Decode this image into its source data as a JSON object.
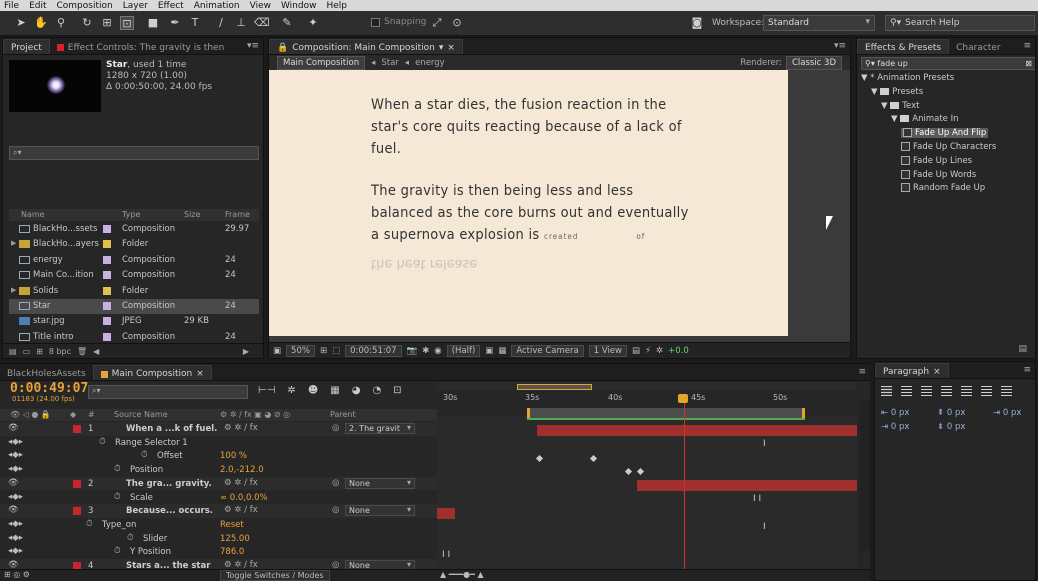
{
  "menu": [
    "File",
    "Edit",
    "Composition",
    "Layer",
    "Effect",
    "Animation",
    "View",
    "Window",
    "Help"
  ],
  "toolbar": {
    "snapping_label": "Snapping",
    "workspace_label": "Workspace:",
    "workspace_value": "Standard",
    "search_placeholder": "Search Help"
  },
  "project_panel": {
    "tabs": [
      "Project",
      "Effect Controls: The gravity is then"
    ],
    "selected_item": {
      "name": "Star",
      "used": ", used 1 time",
      "resolution": "1280 x 720 (1.00)",
      "duration": "Δ 0:00:50:00, 24.00 fps"
    },
    "search_placeholder": "⌕▾",
    "columns": [
      "Name",
      "Type",
      "Size",
      "Frame ..."
    ],
    "items": [
      {
        "name": "BlackHo...ssets",
        "type": "Composition",
        "size": "",
        "frame": "29.97",
        "kind": "comp",
        "swatch": "#c9b0e0"
      },
      {
        "name": "BlackHo...ayers",
        "type": "Folder",
        "size": "",
        "frame": "",
        "kind": "folder",
        "swatch": "#e0c24a"
      },
      {
        "name": "energy",
        "type": "Composition",
        "size": "",
        "frame": "24",
        "kind": "comp",
        "swatch": "#c9b0e0"
      },
      {
        "name": "Main Co...ition",
        "type": "Composition",
        "size": "",
        "frame": "24",
        "kind": "comp",
        "swatch": "#c9b0e0"
      },
      {
        "name": "Solids",
        "type": "Folder",
        "size": "",
        "frame": "",
        "kind": "folder",
        "swatch": "#e0c24a"
      },
      {
        "name": "Star",
        "type": "Composition",
        "size": "",
        "frame": "24",
        "kind": "comp",
        "swatch": "#c9b0e0",
        "selected": true
      },
      {
        "name": "star.jpg",
        "type": "JPEG",
        "size": "29 KB",
        "frame": "",
        "kind": "img",
        "swatch": "#c9b0e0"
      },
      {
        "name": "Title intro",
        "type": "Composition",
        "size": "",
        "frame": "24",
        "kind": "comp",
        "swatch": "#c9b0e0"
      }
    ],
    "bpc": "8 bpc"
  },
  "comp_panel": {
    "tab": "Composition: Main Composition",
    "breadcrumbs": [
      "Main Composition",
      "Star",
      "energy"
    ],
    "renderer_label": "Renderer:",
    "renderer_value": "Classic 3D",
    "text_line1": "When a star dies, the fusion reaction in the",
    "text_line2": "star's core quits reacting because of a lack of",
    "text_line3": "fuel.",
    "text_line4": "The gravity is then being less and less",
    "text_line5": "balanced as the core burns out and eventually",
    "text_line6": "a supernova explosion is",
    "text_created": "created",
    "text_of": "of",
    "text_ghost": "the heat release",
    "footer": {
      "zoom": "50%",
      "timecode": "0:00:51:07",
      "resolution": "(Half)",
      "camera": "Active Camera",
      "views": "1 View",
      "exposure": "+0.0"
    }
  },
  "effects_panel": {
    "tabs": [
      "Effects & Presets",
      "Character"
    ],
    "search_value": "fade up",
    "tree": [
      {
        "label": "* Animation Presets",
        "depth": 0,
        "kind": "root"
      },
      {
        "label": "Presets",
        "depth": 1,
        "kind": "folder"
      },
      {
        "label": "Text",
        "depth": 2,
        "kind": "folder"
      },
      {
        "label": "Animate In",
        "depth": 3,
        "kind": "folder"
      },
      {
        "label": "Fade Up And Flip",
        "depth": 4,
        "kind": "preset",
        "selected": true
      },
      {
        "label": "Fade Up Characters",
        "depth": 4,
        "kind": "preset"
      },
      {
        "label": "Fade Up Lines",
        "depth": 4,
        "kind": "preset"
      },
      {
        "label": "Fade Up Words",
        "depth": 4,
        "kind": "preset"
      },
      {
        "label": "Random Fade Up",
        "depth": 4,
        "kind": "preset"
      }
    ]
  },
  "paragraph_panel": {
    "tab": "Paragraph",
    "indent_values": [
      "0 px",
      "0 px",
      "0 px",
      "0 px",
      "0 px"
    ]
  },
  "timeline": {
    "tabs": [
      "BlackHolesAssets",
      "Main Composition"
    ],
    "timecode": "0:00:49:07",
    "fps_line": "01183 (24.00 fps)",
    "search_placeholder": "⌕▾",
    "columns": [
      "#",
      "Source Name",
      "Parent"
    ],
    "ruler": [
      "30s",
      "35s",
      "40s",
      "45s",
      "50s"
    ],
    "footer_toggle": "Toggle Switches / Modes",
    "rows": [
      {
        "kind": "layer",
        "num": "1",
        "name": "When a ...k of fuel.",
        "parent": "2. The gravit"
      },
      {
        "kind": "prop",
        "name": "Range Selector 1",
        "value": "",
        "indent": 115
      },
      {
        "kind": "prop",
        "name": "Offset",
        "value": "100 %",
        "indent": 157
      },
      {
        "kind": "prop",
        "name": "Position",
        "value": "2.0,-212.0",
        "indent": 130
      },
      {
        "kind": "layer",
        "num": "2",
        "name": "The gra... gravity.",
        "parent": "None"
      },
      {
        "kind": "prop",
        "name": "Scale",
        "value": "∞ 0.0,0.0%",
        "indent": 130
      },
      {
        "kind": "layer",
        "num": "3",
        "name": "Because... occurs.",
        "parent": "None"
      },
      {
        "kind": "prop",
        "name": "Type_on",
        "value": "Reset",
        "indent": 102
      },
      {
        "kind": "prop",
        "name": "Slider",
        "value": "125.00",
        "indent": 143
      },
      {
        "kind": "prop",
        "name": "Y Position",
        "value": "786.0",
        "indent": 130
      },
      {
        "kind": "layer",
        "num": "4",
        "name": "Stars a... the star",
        "parent": "None"
      }
    ]
  },
  "colors": {
    "accent_orange": "#e8a33a",
    "label_red": "#c8262c",
    "playhead": "#d03030"
  }
}
